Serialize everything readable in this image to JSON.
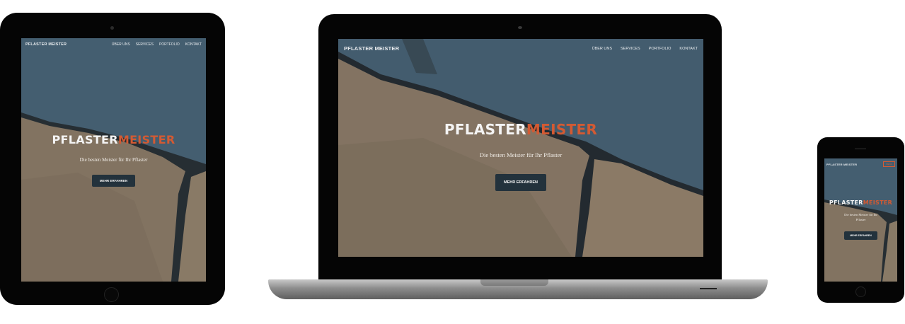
{
  "site": {
    "brand": "PFLASTER MEISTER",
    "nav": [
      "ÜBER UNS",
      "SERVICES",
      "PORTFOLIO",
      "KONTAKT"
    ],
    "menu_button": "MENU",
    "hero_title_part1": "PFLASTER",
    "hero_title_part2": "MEISTER",
    "hero_subtitle": "Die besten Meister für Ihr Pflaster",
    "cta_label": "MEHR ERFAHREN"
  },
  "colors": {
    "accent": "#d35a33",
    "button_bg": "#23323c",
    "device_frame": "#050505",
    "laptop_base": "#8c8c8c"
  }
}
